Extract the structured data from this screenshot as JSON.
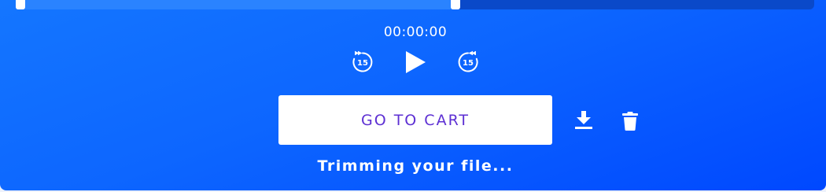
{
  "player": {
    "time": "00:00:00",
    "rewind_seconds": "15",
    "forward_seconds": "15",
    "trim_selection_fraction": 0.55
  },
  "actions": {
    "cart_label": "GO TO CART"
  },
  "status": {
    "message": "Trimming your file..."
  },
  "colors": {
    "accent": "#0d66ff",
    "button_text": "#5d2fd3"
  },
  "icons": [
    "rewind-15-icon",
    "play-icon",
    "forward-15-icon",
    "download-icon",
    "trash-icon"
  ]
}
